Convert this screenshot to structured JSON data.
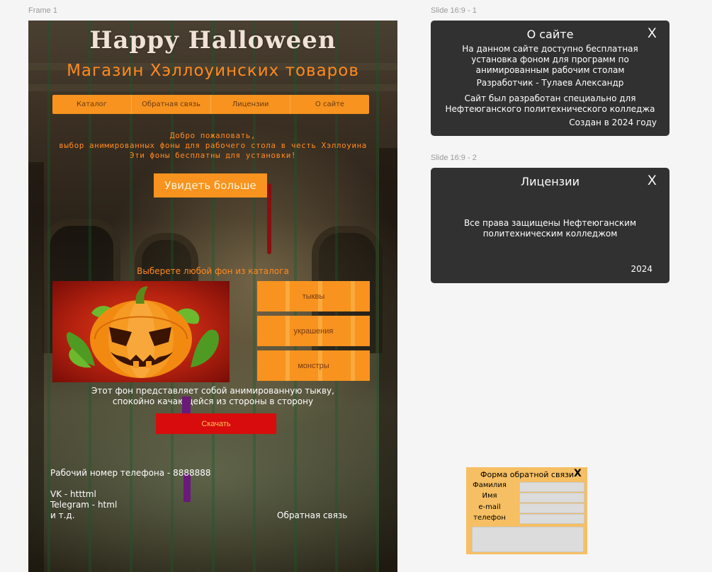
{
  "labels": {
    "frame1": "Frame 1",
    "slide1": "Slide 16:9 - 1",
    "slide2": "Slide 16:9 - 2"
  },
  "site": {
    "title": "Happy Halloween",
    "subtitle": "Магазин Хэллоуинских товаров",
    "nav": [
      "Каталог",
      "Обратная связь",
      "Лицензии",
      "О сайте"
    ],
    "welcome": [
      "Добро пожаловать,",
      "выбор анимированных фоны для рабочего стола в честь Хэллоуина",
      "Эти фоны бесплатны для установки!"
    ],
    "see_more": "Увидеть больше",
    "choose": "Выберете любой фон из каталога",
    "categories": [
      "тыквы",
      "украшения",
      "монстры"
    ],
    "bg_description": [
      "Этот фон представляет собой анимированную тыкву,",
      "спокойно качающейся из стороны в сторону"
    ],
    "download": "Скачать",
    "phone": "Рабочий номер телефона - 8888888",
    "social": [
      "VK - htttml",
      "Telegram - html",
      "и т.д."
    ],
    "feedback_link": "Обратная связь"
  },
  "about": {
    "title": "О сайте",
    "close": "X",
    "description": [
      "На данном сайте доступно бесплатная",
      "установка фоном для программ по",
      "анимированным рабочим столам"
    ],
    "developer": "Разработчик - Тулаев Александр",
    "made_for": [
      "Сайт был разработан специально для",
      "Нефтеюганского политехнического колледжа"
    ],
    "created": "Создан в 2024 году"
  },
  "licenses": {
    "title": "Лицензии",
    "close": "X",
    "text": [
      "Все права защищены Нефтеюганским",
      "политехническим колледжом"
    ],
    "year": "2024"
  },
  "feedback_form": {
    "title": "Форма обратной связи",
    "close": "X",
    "fields": [
      "Фамилия",
      "Имя",
      "e-mail",
      "телефон"
    ]
  }
}
